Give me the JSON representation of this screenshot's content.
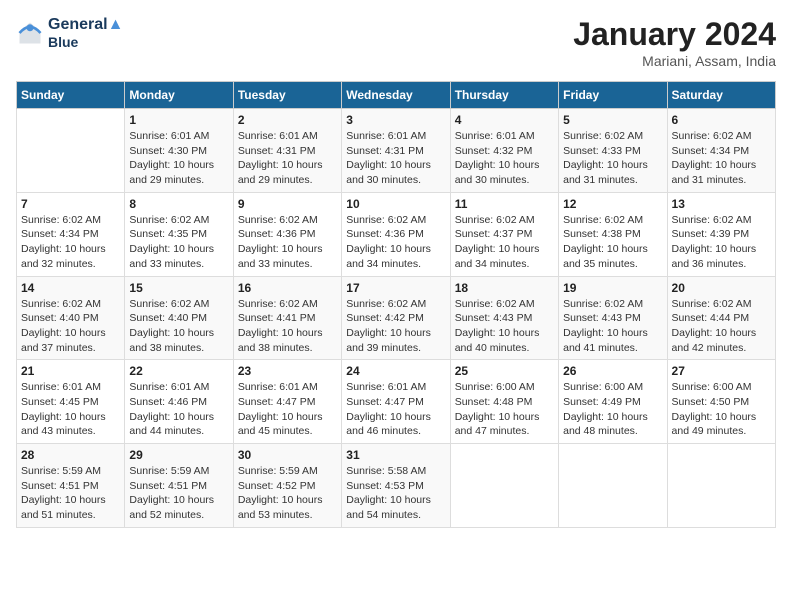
{
  "logo": {
    "line1": "General",
    "line2": "Blue"
  },
  "title": "January 2024",
  "subtitle": "Mariani, Assam, India",
  "days_header": [
    "Sunday",
    "Monday",
    "Tuesday",
    "Wednesday",
    "Thursday",
    "Friday",
    "Saturday"
  ],
  "weeks": [
    [
      {
        "day": "",
        "info": ""
      },
      {
        "day": "1",
        "info": "Sunrise: 6:01 AM\nSunset: 4:30 PM\nDaylight: 10 hours\nand 29 minutes."
      },
      {
        "day": "2",
        "info": "Sunrise: 6:01 AM\nSunset: 4:31 PM\nDaylight: 10 hours\nand 29 minutes."
      },
      {
        "day": "3",
        "info": "Sunrise: 6:01 AM\nSunset: 4:31 PM\nDaylight: 10 hours\nand 30 minutes."
      },
      {
        "day": "4",
        "info": "Sunrise: 6:01 AM\nSunset: 4:32 PM\nDaylight: 10 hours\nand 30 minutes."
      },
      {
        "day": "5",
        "info": "Sunrise: 6:02 AM\nSunset: 4:33 PM\nDaylight: 10 hours\nand 31 minutes."
      },
      {
        "day": "6",
        "info": "Sunrise: 6:02 AM\nSunset: 4:34 PM\nDaylight: 10 hours\nand 31 minutes."
      }
    ],
    [
      {
        "day": "7",
        "info": "Sunrise: 6:02 AM\nSunset: 4:34 PM\nDaylight: 10 hours\nand 32 minutes."
      },
      {
        "day": "8",
        "info": "Sunrise: 6:02 AM\nSunset: 4:35 PM\nDaylight: 10 hours\nand 33 minutes."
      },
      {
        "day": "9",
        "info": "Sunrise: 6:02 AM\nSunset: 4:36 PM\nDaylight: 10 hours\nand 33 minutes."
      },
      {
        "day": "10",
        "info": "Sunrise: 6:02 AM\nSunset: 4:36 PM\nDaylight: 10 hours\nand 34 minutes."
      },
      {
        "day": "11",
        "info": "Sunrise: 6:02 AM\nSunset: 4:37 PM\nDaylight: 10 hours\nand 34 minutes."
      },
      {
        "day": "12",
        "info": "Sunrise: 6:02 AM\nSunset: 4:38 PM\nDaylight: 10 hours\nand 35 minutes."
      },
      {
        "day": "13",
        "info": "Sunrise: 6:02 AM\nSunset: 4:39 PM\nDaylight: 10 hours\nand 36 minutes."
      }
    ],
    [
      {
        "day": "14",
        "info": "Sunrise: 6:02 AM\nSunset: 4:40 PM\nDaylight: 10 hours\nand 37 minutes."
      },
      {
        "day": "15",
        "info": "Sunrise: 6:02 AM\nSunset: 4:40 PM\nDaylight: 10 hours\nand 38 minutes."
      },
      {
        "day": "16",
        "info": "Sunrise: 6:02 AM\nSunset: 4:41 PM\nDaylight: 10 hours\nand 38 minutes."
      },
      {
        "day": "17",
        "info": "Sunrise: 6:02 AM\nSunset: 4:42 PM\nDaylight: 10 hours\nand 39 minutes."
      },
      {
        "day": "18",
        "info": "Sunrise: 6:02 AM\nSunset: 4:43 PM\nDaylight: 10 hours\nand 40 minutes."
      },
      {
        "day": "19",
        "info": "Sunrise: 6:02 AM\nSunset: 4:43 PM\nDaylight: 10 hours\nand 41 minutes."
      },
      {
        "day": "20",
        "info": "Sunrise: 6:02 AM\nSunset: 4:44 PM\nDaylight: 10 hours\nand 42 minutes."
      }
    ],
    [
      {
        "day": "21",
        "info": "Sunrise: 6:01 AM\nSunset: 4:45 PM\nDaylight: 10 hours\nand 43 minutes."
      },
      {
        "day": "22",
        "info": "Sunrise: 6:01 AM\nSunset: 4:46 PM\nDaylight: 10 hours\nand 44 minutes."
      },
      {
        "day": "23",
        "info": "Sunrise: 6:01 AM\nSunset: 4:47 PM\nDaylight: 10 hours\nand 45 minutes."
      },
      {
        "day": "24",
        "info": "Sunrise: 6:01 AM\nSunset: 4:47 PM\nDaylight: 10 hours\nand 46 minutes."
      },
      {
        "day": "25",
        "info": "Sunrise: 6:00 AM\nSunset: 4:48 PM\nDaylight: 10 hours\nand 47 minutes."
      },
      {
        "day": "26",
        "info": "Sunrise: 6:00 AM\nSunset: 4:49 PM\nDaylight: 10 hours\nand 48 minutes."
      },
      {
        "day": "27",
        "info": "Sunrise: 6:00 AM\nSunset: 4:50 PM\nDaylight: 10 hours\nand 49 minutes."
      }
    ],
    [
      {
        "day": "28",
        "info": "Sunrise: 5:59 AM\nSunset: 4:51 PM\nDaylight: 10 hours\nand 51 minutes."
      },
      {
        "day": "29",
        "info": "Sunrise: 5:59 AM\nSunset: 4:51 PM\nDaylight: 10 hours\nand 52 minutes."
      },
      {
        "day": "30",
        "info": "Sunrise: 5:59 AM\nSunset: 4:52 PM\nDaylight: 10 hours\nand 53 minutes."
      },
      {
        "day": "31",
        "info": "Sunrise: 5:58 AM\nSunset: 4:53 PM\nDaylight: 10 hours\nand 54 minutes."
      },
      {
        "day": "",
        "info": ""
      },
      {
        "day": "",
        "info": ""
      },
      {
        "day": "",
        "info": ""
      }
    ]
  ]
}
